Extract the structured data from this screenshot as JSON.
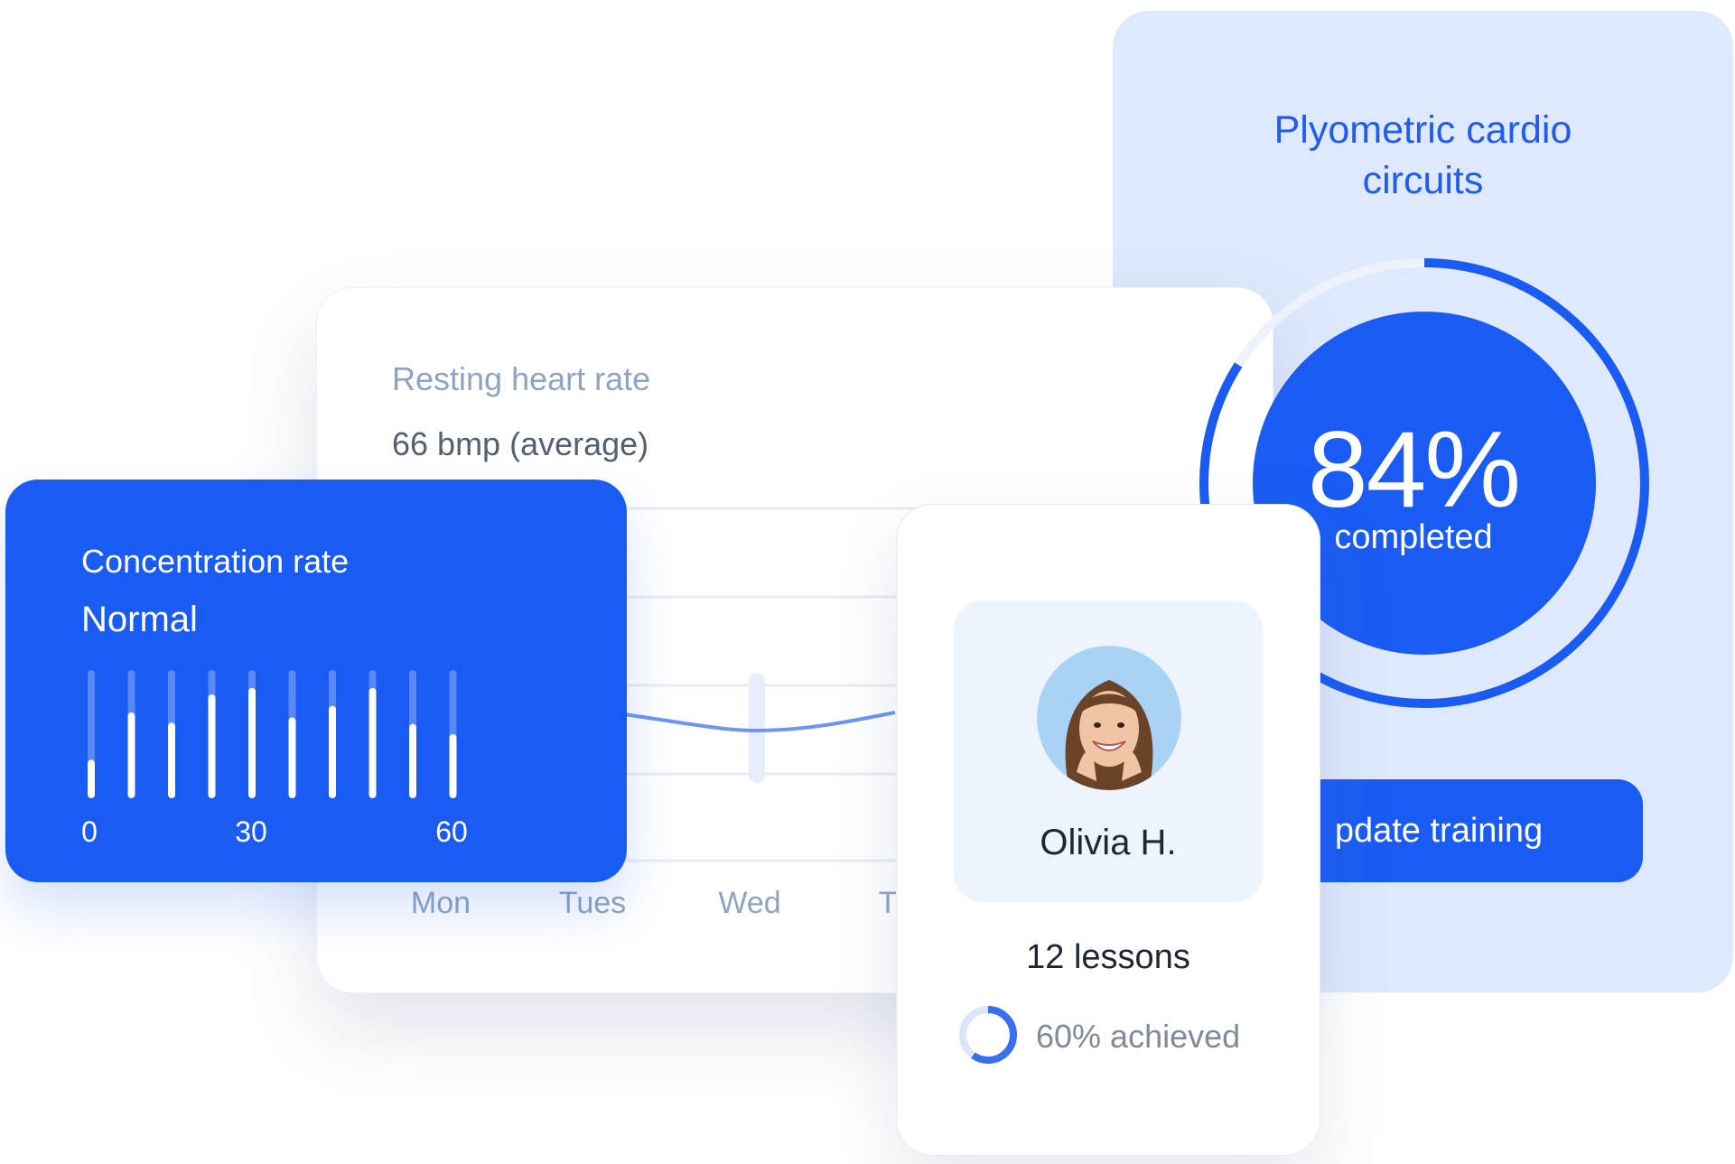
{
  "cardio": {
    "title_line1": "Plyometric cardio",
    "title_line2": "circuits",
    "percent_text": "84%",
    "percent_value": 84,
    "percent_label": "completed",
    "button_label": "pdate training"
  },
  "heart_rate": {
    "title": "Resting heart rate",
    "value": "66 bmp (average)",
    "days": [
      "Mon",
      "Tues",
      "Wed",
      "T"
    ]
  },
  "concentration": {
    "title": "Concentration rate",
    "status": "Normal",
    "bars": [
      0.3,
      0.67,
      0.59,
      0.81,
      0.86,
      0.63,
      0.72,
      0.86,
      0.58,
      0.5
    ],
    "ticks": [
      "0",
      "30",
      "60"
    ]
  },
  "profile": {
    "name": "Olivia H.",
    "lessons": "12 lessons",
    "achieved_text": "60% achieved",
    "achieved_value": 60
  },
  "colors": {
    "accent": "#1a5cf3",
    "light_panel": "#dfe9fd",
    "muted_text": "#8fa4c2"
  }
}
